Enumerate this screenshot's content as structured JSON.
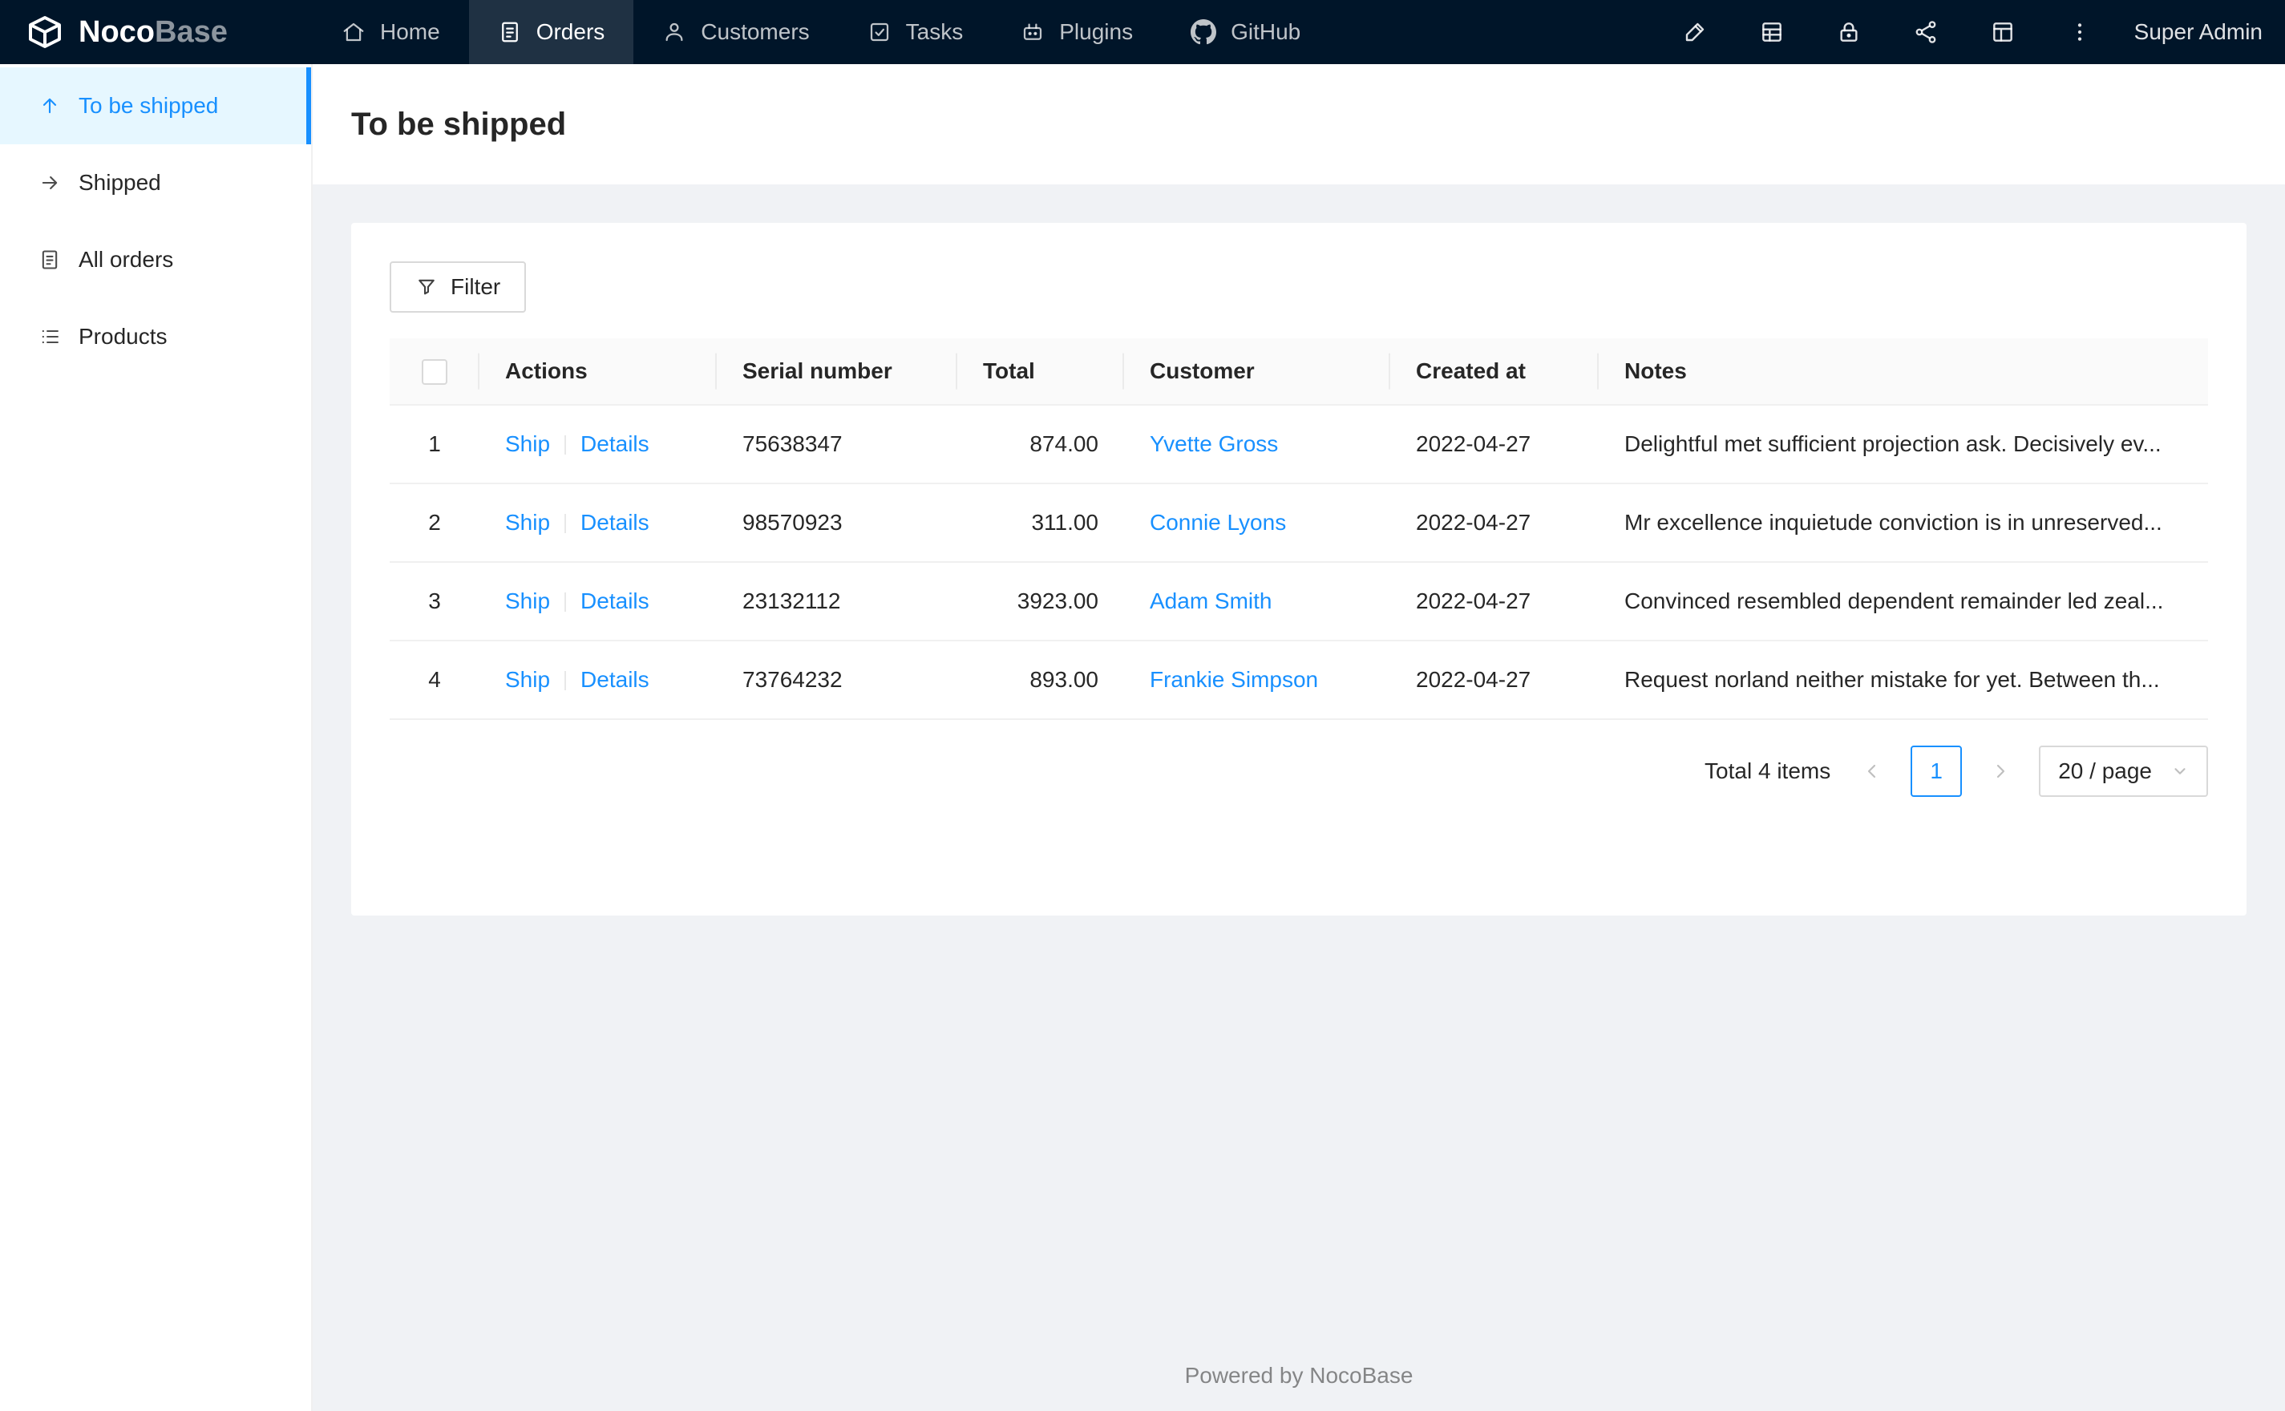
{
  "app": {
    "logo_primary": "Noco",
    "logo_secondary": "Base",
    "user_name": "Super Admin"
  },
  "topnav": {
    "items": [
      {
        "label": "Home",
        "icon": "home-icon",
        "active": false
      },
      {
        "label": "Orders",
        "icon": "orders-icon",
        "active": true
      },
      {
        "label": "Customers",
        "icon": "customers-icon",
        "active": false
      },
      {
        "label": "Tasks",
        "icon": "tasks-icon",
        "active": false
      },
      {
        "label": "Plugins",
        "icon": "plugins-icon",
        "active": false
      },
      {
        "label": "GitHub",
        "icon": "github-icon",
        "active": false
      }
    ],
    "right_icons": [
      "ui-editor-icon",
      "collections-icon",
      "lock-icon",
      "workflow-icon",
      "layout-icon",
      "more-icon"
    ]
  },
  "sidebar": {
    "items": [
      {
        "label": "To be shipped",
        "icon": "arrow-up-icon",
        "active": true
      },
      {
        "label": "Shipped",
        "icon": "arrow-right-icon",
        "active": false
      },
      {
        "label": "All orders",
        "icon": "orders-doc-icon",
        "active": false
      },
      {
        "label": "Products",
        "icon": "list-icon",
        "active": false
      }
    ]
  },
  "page": {
    "title": "To be shipped"
  },
  "toolbar": {
    "filter_label": "Filter"
  },
  "table": {
    "columns": [
      "Actions",
      "Serial number",
      "Total",
      "Customer",
      "Created at",
      "Notes"
    ],
    "action_labels": {
      "ship": "Ship",
      "details": "Details"
    },
    "rows": [
      {
        "index": "1",
        "serial": "75638347",
        "total": "874.00",
        "customer": "Yvette Gross",
        "created": "2022-04-27",
        "notes": "Delightful met sufficient projection ask. Decisively ev..."
      },
      {
        "index": "2",
        "serial": "98570923",
        "total": "311.00",
        "customer": "Connie Lyons",
        "created": "2022-04-27",
        "notes": "Mr excellence inquietude conviction is in unreserved..."
      },
      {
        "index": "3",
        "serial": "23132112",
        "total": "3923.00",
        "customer": "Adam Smith",
        "created": "2022-04-27",
        "notes": "Convinced resembled dependent remainder led zeal..."
      },
      {
        "index": "4",
        "serial": "73764232",
        "total": "893.00",
        "customer": "Frankie Simpson",
        "created": "2022-04-27",
        "notes": "Request norland neither mistake for yet. Between th..."
      }
    ]
  },
  "pagination": {
    "total_text": "Total 4 items",
    "current_page": "1",
    "page_size": "20 / page"
  },
  "footer": {
    "text": "Powered by NocoBase"
  },
  "colors": {
    "primary": "#1890ff",
    "header_bg": "#001529",
    "sidebar_active_bg": "#e6f7ff",
    "body_bg": "#f0f2f5",
    "link": "#1890ff"
  }
}
